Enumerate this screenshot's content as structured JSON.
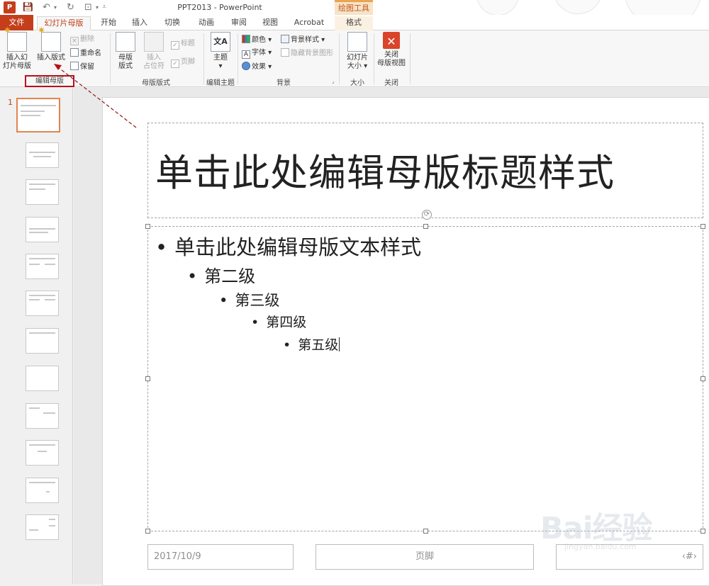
{
  "window": {
    "title": "PPT2013 - PowerPoint",
    "contextual_group": "绘图工具",
    "app_icon": "P"
  },
  "quick_access": {
    "icons": [
      "powerpoint-logo-icon",
      "save-icon",
      "undo-icon",
      "redo-icon",
      "present-icon",
      "customize-icon"
    ]
  },
  "tabs": {
    "file": "文件",
    "slide_master": "幻灯片母版",
    "home": "开始",
    "insert": "插入",
    "transitions": "切换",
    "animations": "动画",
    "review": "审阅",
    "view": "视图",
    "acrobat": "Acrobat",
    "format": "格式"
  },
  "ribbon": {
    "edit_master": {
      "label": "编辑母版",
      "insert_slide_master": [
        "插入幻",
        "灯片母版"
      ],
      "insert_layout": "插入版式",
      "delete": "删除",
      "rename": "重命名",
      "preserve": "保留"
    },
    "master_layout": {
      "label": "母版版式",
      "master_layout_btn": [
        "母版",
        "版式"
      ],
      "insert_placeholder": [
        "插入",
        "占位符"
      ],
      "title_chk": "标题",
      "footer_chk": "页脚"
    },
    "edit_theme": {
      "label": "编辑主题",
      "themes": "主题",
      "theme_icon": "文A"
    },
    "background": {
      "label": "背景",
      "colors": "颜色",
      "fonts": "字体",
      "effects": "效果",
      "background_styles": "背景样式",
      "hide_bg_graphics": "隐藏背景图形"
    },
    "size": {
      "label": "大小",
      "slide_size": [
        "幻灯片",
        "大小"
      ]
    },
    "close": {
      "label": "关闭",
      "close_master_view": [
        "关闭",
        "母版视图"
      ]
    }
  },
  "thumbnails": {
    "selected_number": "1",
    "count": 12
  },
  "slide": {
    "title": "单击此处编辑母版标题样式",
    "levels": [
      "单击此处编辑母版文本样式",
      "第二级",
      "第三级",
      "第四级",
      "第五级"
    ],
    "bullet": "•",
    "date": "2017/10/9",
    "footer": "页脚",
    "number": "‹#›"
  },
  "watermark": {
    "logo": "Bai经验",
    "url": "jingyan.baidu.com"
  },
  "colors": {
    "accent": "#c43e1c",
    "highlight_box": "#b5121b",
    "contextual": "#e8a553"
  }
}
